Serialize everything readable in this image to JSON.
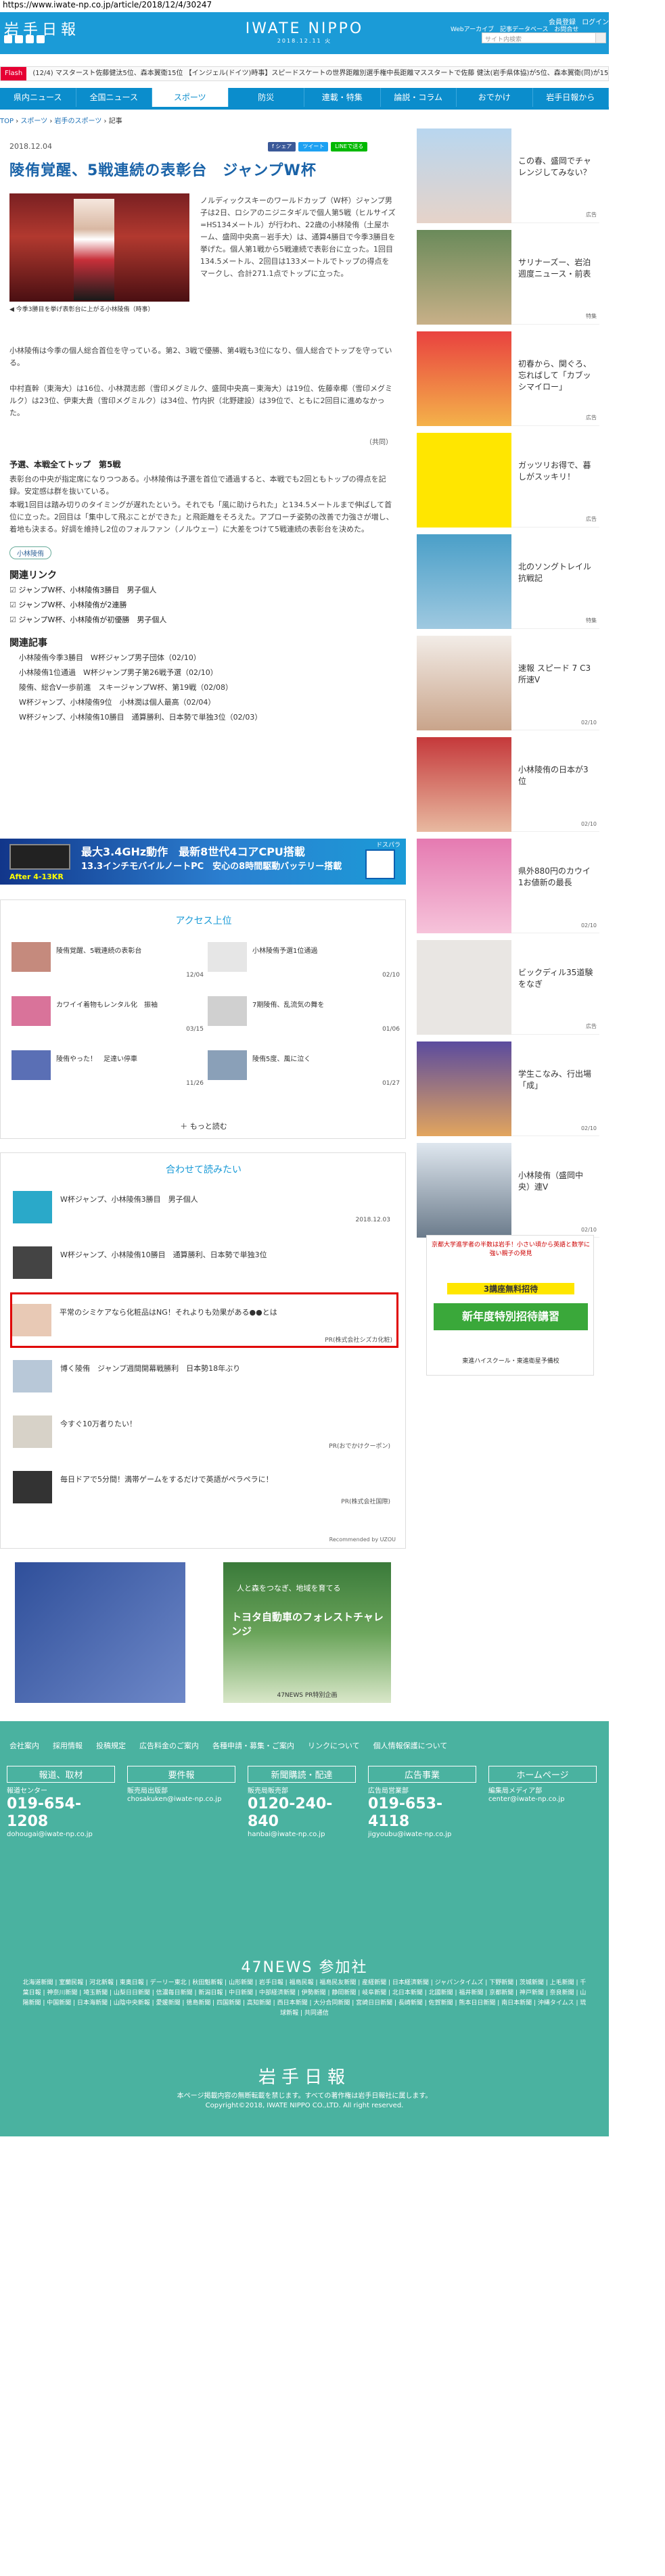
{
  "url": "https://www.iwate-np.co.jp/article/2018/12/4/30247",
  "header": {
    "logo": "岩手日報",
    "brand": "IWATE NIPPO",
    "brand_date": "2018.12.11 火",
    "login": [
      "会員登録",
      "ログイン"
    ],
    "web_links": [
      "Webアーカイブ",
      "記事データベース",
      "お問合せ"
    ],
    "search_placeholder": "サイト内検索"
  },
  "flash": {
    "label": "Flash",
    "items": [
      "(12/4) マスタースト佐藤健汰5位、森本翼衛15位",
      "【インジェル(ドイツ)時事】スピードスケートの世界距離別選手権中長距離マススタートで佐藤",
      "健汰(岩手県体協)が5位、森本翼衛(同)が15位に入った。"
    ]
  },
  "nav": [
    "県内ニュース",
    "全国ニュース",
    "スポーツ",
    "防災",
    "連載・特集",
    "論説・コラム",
    "おでかけ",
    "岩手日報から"
  ],
  "breadcrumb": [
    "TOP",
    "スポーツ",
    "岩手のスポーツ",
    "記事"
  ],
  "article": {
    "date": "2018.12.04",
    "share": [
      "f シェア",
      "ツイート",
      "LINEで送る"
    ],
    "title": "陵侑覚醒、5戦連続の表彰台　ジャンプW杯",
    "caption": "◀ 今季3勝目を挙げ表彰台に上がる小林陵侑（時事）",
    "lead": "ノルディックスキーのワールドカップ（W杯）ジャンプ男子は2日、ロシアのニジニタギルで個人第5戦（ヒルサイズ=HS134メートル）が行われ、22歳の小林陵侑（土屋ホーム、盛岡中央高－岩手大）は、通算4勝目で今季3勝目を挙げた。個人第1戦から5戦連続で表彰台に立った。1回目134.5メートル、2回目は133メートルでトップの得点をマークし、合計271.1点でトップに立った。",
    "p1": "小林陵侑は今季の個人総合首位を守っている。第2、3戦で優勝、第4戦も3位になり、個人総合でトップを守っている。",
    "p2": "中村直幹（東海大）は16位、小林潤志郎（雪印メグミルク、盛岡中央高－東海大）は19位、佐藤幸椰（雪印メグミルク）は23位、伊東大貴（雪印メグミルク）は34位、竹内択（北野建設）は39位で、ともに2回目に進めなかった。",
    "source": "（共同）",
    "subhead": "予選、本戦全てトップ　第5戦",
    "p3": "表彰台の中央が指定席になりつつある。小林陵侑は予選を首位で通過すると、本戦でも2回ともトップの得点を記録。安定感は群を抜いている。",
    "p4": "本戦1回目は踏み切りのタイミングが遅れたという。それでも「風に助けられた」と134.5メートルまで伸ばして首位に立った。2回目は「集中して飛ぶことができた」と飛距離をそろえた。アプローチ姿勢の改善で力強さが増し、着地も決まる。好調を維持し2位のフォルファン（ノルウェー）に大差をつけて5戦連続の表彰台を決めた。",
    "tag": "小林陵侑"
  },
  "related_links": {
    "heading": "関連リンク",
    "items": [
      "ジャンプW杯、小林陵侑3勝目　男子個人",
      "ジャンプW杯、小林陵侑が2連勝",
      "ジャンプW杯、小林陵侑が初優勝　男子個人"
    ]
  },
  "related_articles": {
    "heading": "関連記事",
    "items": [
      "小林陵侑今季3勝目　W杯ジャンプ男子団体（02/10）",
      "小林陵侑1位通過　W杯ジャンプ男子第26戦予選（02/10）",
      "陵侑、総合V一歩前進　スキージャンプW杯、第19戦（02/08）",
      "W杯ジャンプ、小林陵侑9位　小林潤は個人最高（02/04）",
      "W杯ジャンプ、小林陵侑10勝目　通算勝利、日本勢で単独3位（02/03）"
    ]
  },
  "ad_banner": {
    "line1": "最大3.4GHz動作　最新8世代4コアCPU搭載",
    "line2": "13.3インチモバイルノートPC　安心の8時間駆動バッテリー搭載",
    "line3": "After 4-13KR",
    "label": "ドスパラ"
  },
  "access": {
    "heading": "アクセス上位",
    "items": [
      {
        "title": "陵侑覚醒、5戦連続の表彰台",
        "date": "12/04"
      },
      {
        "title": "小林陵侑予選1位通過",
        "date": "02/10"
      },
      {
        "title": "カワイイ着物もレンタル化　振袖",
        "date": "03/15"
      },
      {
        "title": "7期陵侑、乱流気の舞を",
        "date": "01/06"
      },
      {
        "title": "陵侑やった！　足達い停車",
        "date": "11/26"
      },
      {
        "title": "陵侑5度、風に泣く",
        "date": "01/27"
      }
    ],
    "more": "もっと読む"
  },
  "recommend": {
    "heading": "合わせて読みたい",
    "items": [
      {
        "title": "W杯ジャンプ、小林陵侑3勝目　男子個人",
        "pr": "2018.12.03"
      },
      {
        "title": "W杯ジャンプ、小林陵侑10勝目　通算勝利、日本勢で単独3位",
        "pr": ""
      },
      {
        "title": "平常のシミケアなら化粧品はNG！それよりも効果がある●●とは",
        "pr": "PR(株式会社シズカ化粧)"
      },
      {
        "title": "博く陵侑　ジャンプ週間開幕戦勝利　日本勢18年ぶり",
        "pr": ""
      },
      {
        "title": "今すぐ10万者りたい！",
        "pr": "PR(おでかけクーポン)"
      },
      {
        "title": "毎日ドアで5分間！満帯ゲームをするだけで英語がペラペラに！",
        "pr": "PR(株式会社国際)"
      }
    ],
    "powered": "Recommended by UZOU"
  },
  "sidebar": [
    {
      "text": "この春、盛岡でチャレンジしてみない？",
      "cat": "広告"
    },
    {
      "text": "サリナーズー、岩泊週度ニュース・前表",
      "cat": "特集"
    },
    {
      "text": "初春から、関ぐろ、忘ればして「カブッシマイロー」",
      "cat": "広告"
    },
    {
      "text": "ガッツリお得で、暮しがスッキリ！",
      "cat": "広告"
    },
    {
      "text": "北のソングトレイル抗戦記",
      "cat": "特集"
    },
    {
      "text": "速報 スピード 7 C3所速V",
      "cat": "02/10"
    },
    {
      "text": "小林陵侑の日本が3位",
      "cat": "02/10"
    },
    {
      "text": "県外880円のカウイ1お値新の最長",
      "cat": "02/10"
    },
    {
      "text": "ビックディル35道験をなぎ",
      "cat": "広告"
    },
    {
      "text": "学生こなみ、行出場「成」",
      "cat": "02/10"
    },
    {
      "text": "小林陵侑（盛岡中央）連V",
      "cat": "02/10"
    }
  ],
  "side_ad": {
    "line1": "京都大学進学者の半数は岩手！小さい頃から英語と数学に強い親子の発見",
    "line2": "3講座無料招待",
    "line3": "新年度特別招待講習",
    "line4": "東進ハイスクール・東進衛星予備校"
  },
  "banners": {
    "b2_line1": "人と森をつなぎ、地域を育てる",
    "b2_line2": "トヨタ自動車のフォレストチャレンジ",
    "b2_line3": "47NEWS PR特別企画"
  },
  "footer": {
    "links": [
      "会社案内",
      "採用情報",
      "投稿規定",
      "広告料金のご案内",
      "各種申請・募集・ご案内",
      "リンクについて",
      "個人情報保護について"
    ],
    "cols": [
      {
        "head": "報道、取材",
        "sub": "報道センター",
        "phone": "019-654-1208",
        "mail": "dohougai@iwate-np.co.jp"
      },
      {
        "head": "要件報",
        "sub": "販売局出版部",
        "phone": "",
        "mail": "chosakuken@iwate-np.co.jp"
      },
      {
        "head": "新聞購読・配達",
        "sub": "販売局販売部",
        "phone": "0120-240-840",
        "mail": "hanbai@iwate-np.co.jp"
      },
      {
        "head": "広告事業",
        "sub": "広告局営業部",
        "phone": "019-653-4118",
        "mail": "jigyoubu@iwate-np.co.jp"
      },
      {
        "head": "ホームページ",
        "sub": "編集局メディア部",
        "phone": "",
        "mail": "center@iwate-np.co.jp"
      }
    ],
    "news47": "47NEWS 参加社",
    "papers": "北海道新聞 | 室蘭民報 | 河北新報 | 東奥日報 | デーリー東北 | 秋田魁新報 | 山形新聞 | 岩手日報 | 福島民報 | 福島民友新聞 | 産経新聞 | 日本経済新聞 | ジャパンタイムズ | 下野新聞 | 茨城新聞 | 上毛新聞 | 千葉日報 | 神奈川新聞 | 埼玉新聞 | 山梨日日新聞 | 信濃毎日新聞 | 新潟日報 | 中日新聞 | 中部経済新聞 | 伊勢新聞 | 静岡新聞 | 岐阜新聞 | 北日本新聞 | 北國新聞 | 福井新聞 | 京都新聞 | 神戸新聞 | 奈良新聞 | 山陽新聞 | 中国新聞 | 日本海新聞 | 山陰中央新報 | 愛媛新聞 | 徳島新聞 | 四国新聞 | 高知新聞 | 西日本新聞 | 大分合同新聞 | 宮崎日日新聞 | 長崎新聞 | 佐賀新聞 | 熊本日日新聞 | 南日本新聞 | 沖縄タイムス | 琉球新報 | 共同通信",
    "logo": "岩手日報",
    "copy1": "本ページ掲載内容の無断転載を禁じます。すべての著作権は岩手日報社に属します。",
    "copy2": "Copyright©2018, IWATE NIPPO CO.,LTD. All right reserved."
  },
  "colors": {
    "brand": "#1b9bd7",
    "footer": "#4ab2a0",
    "flash": "#e60033"
  }
}
